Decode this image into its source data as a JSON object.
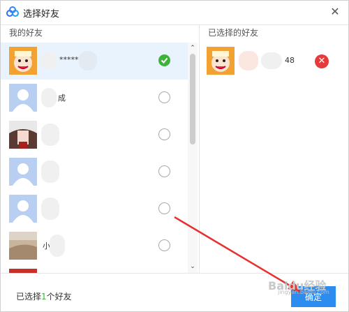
{
  "dialog": {
    "title": "选择好友"
  },
  "left_panel": {
    "label": "我的好友",
    "friends": [
      {
        "name_fragment": "*****",
        "selected": true
      },
      {
        "name_fragment": "成",
        "selected": false
      },
      {
        "name_fragment": "",
        "selected": false
      },
      {
        "name_fragment": "",
        "selected": false
      },
      {
        "name_fragment": "",
        "selected": false
      },
      {
        "name_fragment": "小",
        "selected": false
      }
    ]
  },
  "right_panel": {
    "label": "已选择的好友",
    "selected": [
      {
        "name_suffix": "48"
      }
    ]
  },
  "footer": {
    "count_prefix": "已选择",
    "count": "1",
    "count_suffix": "个好友",
    "ok_label": "确定"
  },
  "watermark": {
    "text": "Baidu经验",
    "sub": "jingyan.baidu.com"
  },
  "colors": {
    "accent": "#2d8cf0",
    "check": "#3fb23e",
    "remove": "#e63b3b",
    "selected_row": "#e9f3fd"
  }
}
